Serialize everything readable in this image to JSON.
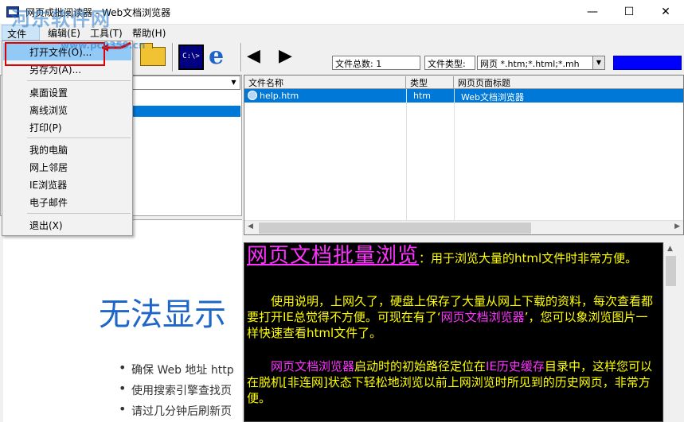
{
  "window": {
    "title": "网页成批阅读器 - Web文档浏览器",
    "min_glyph": "—",
    "max_glyph": "☐",
    "close_glyph": "✕"
  },
  "watermark": {
    "text": "河东软件网",
    "url": "www.pc0359.cn"
  },
  "menubar": {
    "file": "文件(F)",
    "edit": "编辑(E)",
    "tools": "工具(T)",
    "help": "帮助(H)"
  },
  "file_menu": {
    "items": [
      "打开文件(O)...",
      "另存为(A)...",
      "桌面设置",
      "离线浏览",
      "打印(P)",
      "我的电脑",
      "网上邻居",
      "IE浏览器",
      "电子邮件",
      "退出(X)"
    ]
  },
  "toolbar": {
    "cmd_text": "C:\\>",
    "ie_text": "e",
    "back_glyph": "◀",
    "forward_glyph": "▶",
    "file_count": "文件总数: 1",
    "file_type_label": "文件类型:",
    "file_type_value": "网页  *.htm;*.html;*.mh",
    "dropdown_arrow": "▼",
    "progress": 1.0
  },
  "file_list": {
    "columns": [
      "文件名称",
      "类型",
      "网页页面标题"
    ],
    "rows": [
      {
        "name": "help.htm",
        "type": "htm",
        "title": "Web文档浏览器"
      }
    ]
  },
  "error_page": {
    "heading": "无法显示",
    "bullets": [
      "确保 Web 地址 http",
      "使用搜索引擎查找页",
      "请过几分钟后刷新页"
    ]
  },
  "info": {
    "title": "网页文档批量浏览",
    "intro": "：用于浏览大量的html文件时非常方便。",
    "p1_a": "使用说明，上网久了，硬盘上保存了大量从网上下载的资料，每次查看都要打开IE总觉得不方便。可现在有了‘",
    "p1_b": "网页文档浏览器",
    "p1_c": "’，您可以象浏览图片一样快速查看html文件了。",
    "p2_a": "网页文档浏览器",
    "p2_b": "启动时的初始路径定位在",
    "p2_c": "IE历史缓存",
    "p2_d": "目录中，这样您可以在脱机[非连网]状态下轻松地浏览以前上网浏览时所见到的历史网页，非常方便。"
  },
  "colors": {
    "selection": "#0078d7",
    "info_background": "#000000",
    "info_text": "#ffff00",
    "info_accent": "#ff33ff",
    "progress": "#0000ff",
    "highlight": "#e00000"
  }
}
